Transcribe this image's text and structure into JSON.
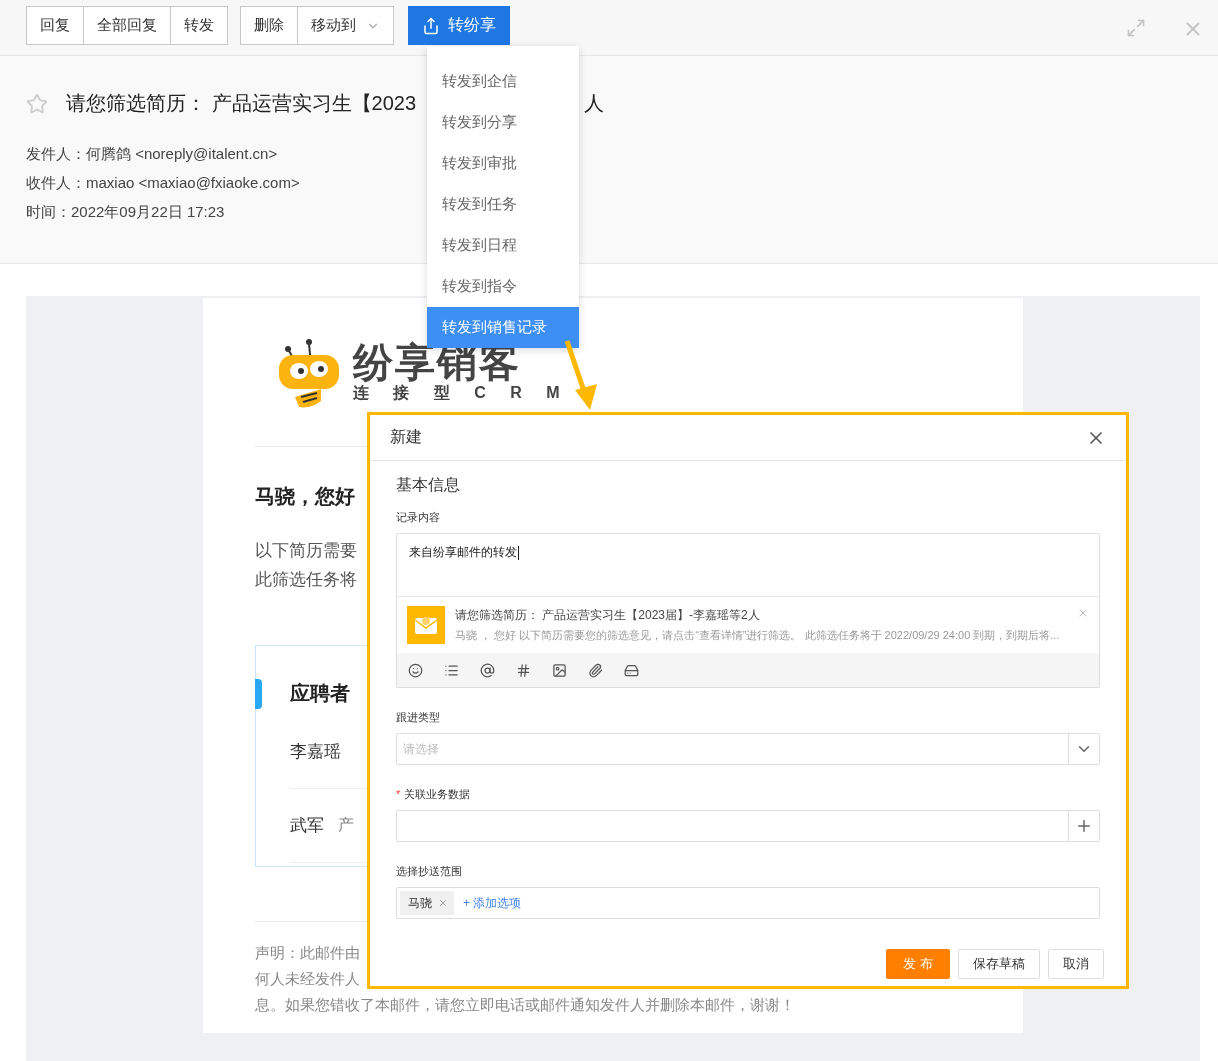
{
  "toolbar": {
    "groups": [
      {
        "buttons": [
          {
            "label": "回复",
            "kind": "plain"
          },
          {
            "label": "全部回复",
            "kind": "plain"
          },
          {
            "label": "转发",
            "kind": "plain"
          }
        ]
      },
      {
        "buttons": [
          {
            "label": "删除",
            "kind": "plain"
          },
          {
            "label": "移动到",
            "kind": "dropdown"
          }
        ]
      }
    ],
    "share_button": {
      "label": "转纷享"
    }
  },
  "share_menu": {
    "items": [
      {
        "label": "转发到企信",
        "selected": false
      },
      {
        "label": "转发到分享",
        "selected": false
      },
      {
        "label": "转发到审批",
        "selected": false
      },
      {
        "label": "转发到任务",
        "selected": false
      },
      {
        "label": "转发到日程",
        "selected": false
      },
      {
        "label": "转发到指令",
        "selected": false
      },
      {
        "label": "转发到销售记录",
        "selected": true
      }
    ]
  },
  "mail": {
    "starred": false,
    "subject": "请您筛选简历： 产品运营实习生【2023",
    "subject_tail": "人",
    "meta": [
      "发件人：何腾鸽 <noreply@italent.cn>",
      "收件人：maxiao <maxiao@fxiaoke.com>",
      "时间：2022年09月22日 17:23"
    ]
  },
  "body": {
    "logo": {
      "name": "纷享销客",
      "slogan": "连 接 型 C R M"
    },
    "greeting": "马骁，您好",
    "paragraphs": [
      "以下简历需要",
      "此筛选任务将"
    ],
    "applicants": {
      "title": "应聘者",
      "rows": [
        {
          "name": "李嘉瑶"
        },
        {
          "name": "武军",
          "detail": "产"
        }
      ]
    },
    "disclaimer": [
      "声明：此邮件由",
      "何人未经发件人",
      "息。如果您错收了本邮件，请您立即电话或邮件通知发件人并删除本邮件，谢谢！"
    ]
  },
  "dialog": {
    "title": "新建",
    "section": "基本信息",
    "content": {
      "label": "记录内容",
      "value": "来自纷享邮件的转发",
      "attachment": {
        "title": "请您筛选简历： 产品运营实习生【2023届】-李嘉瑶等2人",
        "summary": "马骁 ， 您好 以下简历需要您的筛选意见，请点击“查看详情”进行筛选。 此筛选任务将于 2022/09/29 24:00 到期，到期后将..."
      }
    },
    "follow_type": {
      "label": "跟进类型",
      "placeholder": "请选择"
    },
    "related_data": {
      "label": "关联业务数据",
      "required": true,
      "required_mark": "*"
    },
    "cc_scope": {
      "label": "选择抄送范围",
      "tags": [
        "马骁"
      ],
      "add_link": "+ 添加选项"
    },
    "buttons": [
      {
        "label": "发 布",
        "kind": "primary"
      },
      {
        "label": "保存草稿",
        "kind": "default"
      },
      {
        "label": "取消",
        "kind": "default"
      }
    ]
  }
}
